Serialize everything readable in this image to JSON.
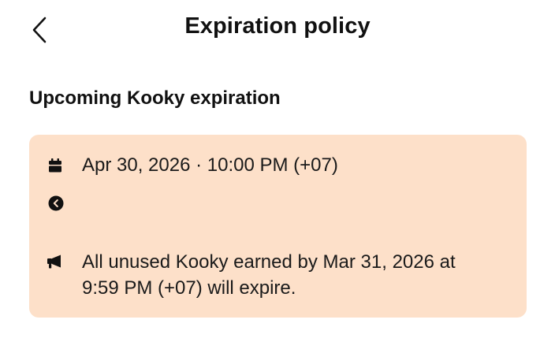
{
  "header": {
    "title": "Expiration policy"
  },
  "section": {
    "title": "Upcoming Kooky expiration"
  },
  "card": {
    "date_text": "Apr 30, 2026 · 10:00 PM (+07)",
    "notice_line1": "All unused Kooky earned by Mar 31, 2026 at",
    "notice_line2": "9:59 PM (+07) will expire.",
    "background_color": "#fde0c9"
  },
  "icons": {
    "back": "chevron-left-icon",
    "date": "calendar-icon",
    "toggle": "chevron-left-circle-icon",
    "notice": "megaphone-icon"
  }
}
